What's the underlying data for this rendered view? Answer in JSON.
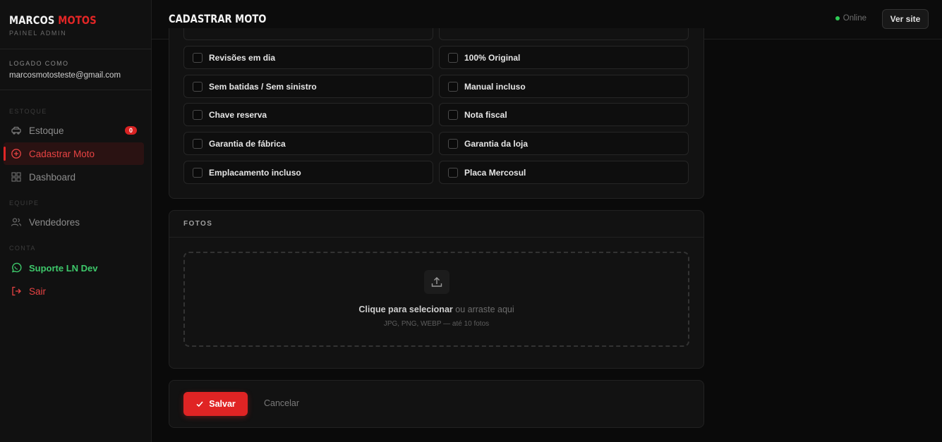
{
  "brand": {
    "name_white": "MARCOS",
    "name_red": "MOTOS",
    "subtitle": "PAINEL ADMIN"
  },
  "user": {
    "label": "LOGADO COMO",
    "email": "marcosmotosteste@gmail.com"
  },
  "sidebar": {
    "sections": {
      "estoque": "ESTOQUE",
      "equipe": "EQUIPE",
      "conta": "CONTA"
    },
    "items": {
      "estoque": {
        "label": "Estoque",
        "badge": "0",
        "icon": "car-icon"
      },
      "cadastrar": {
        "label": "Cadastrar Moto",
        "icon": "plus-circle-icon"
      },
      "dashboard": {
        "label": "Dashboard",
        "icon": "grid-icon"
      },
      "vendedores": {
        "label": "Vendedores",
        "icon": "users-icon"
      },
      "suporte": {
        "label": "Suporte LN Dev",
        "icon": "whatsapp-icon"
      },
      "sair": {
        "label": "Sair",
        "icon": "logout-icon"
      }
    }
  },
  "topbar": {
    "title": "CADASTRAR MOTO",
    "status": "Online",
    "ver_site": "Ver site"
  },
  "checklist": {
    "items": [
      "Revisões em dia",
      "100% Original",
      "Sem batidas / Sem sinistro",
      "Manual incluso",
      "Chave reserva",
      "Nota fiscal",
      "Garantia de fábrica",
      "Garantia da loja",
      "Emplacamento incluso",
      "Placa Mercosul"
    ]
  },
  "fotos": {
    "title": "FOTOS",
    "cta_bold": "Clique para selecionar",
    "cta_rest": " ou arraste aqui",
    "hint": "JPG, PNG, WEBP — até 10 fotos"
  },
  "actions": {
    "save": "Salvar",
    "cancel": "Cancelar"
  },
  "colors": {
    "accent": "#e02424",
    "online": "#2ecc55",
    "support": "#3ec96b"
  }
}
